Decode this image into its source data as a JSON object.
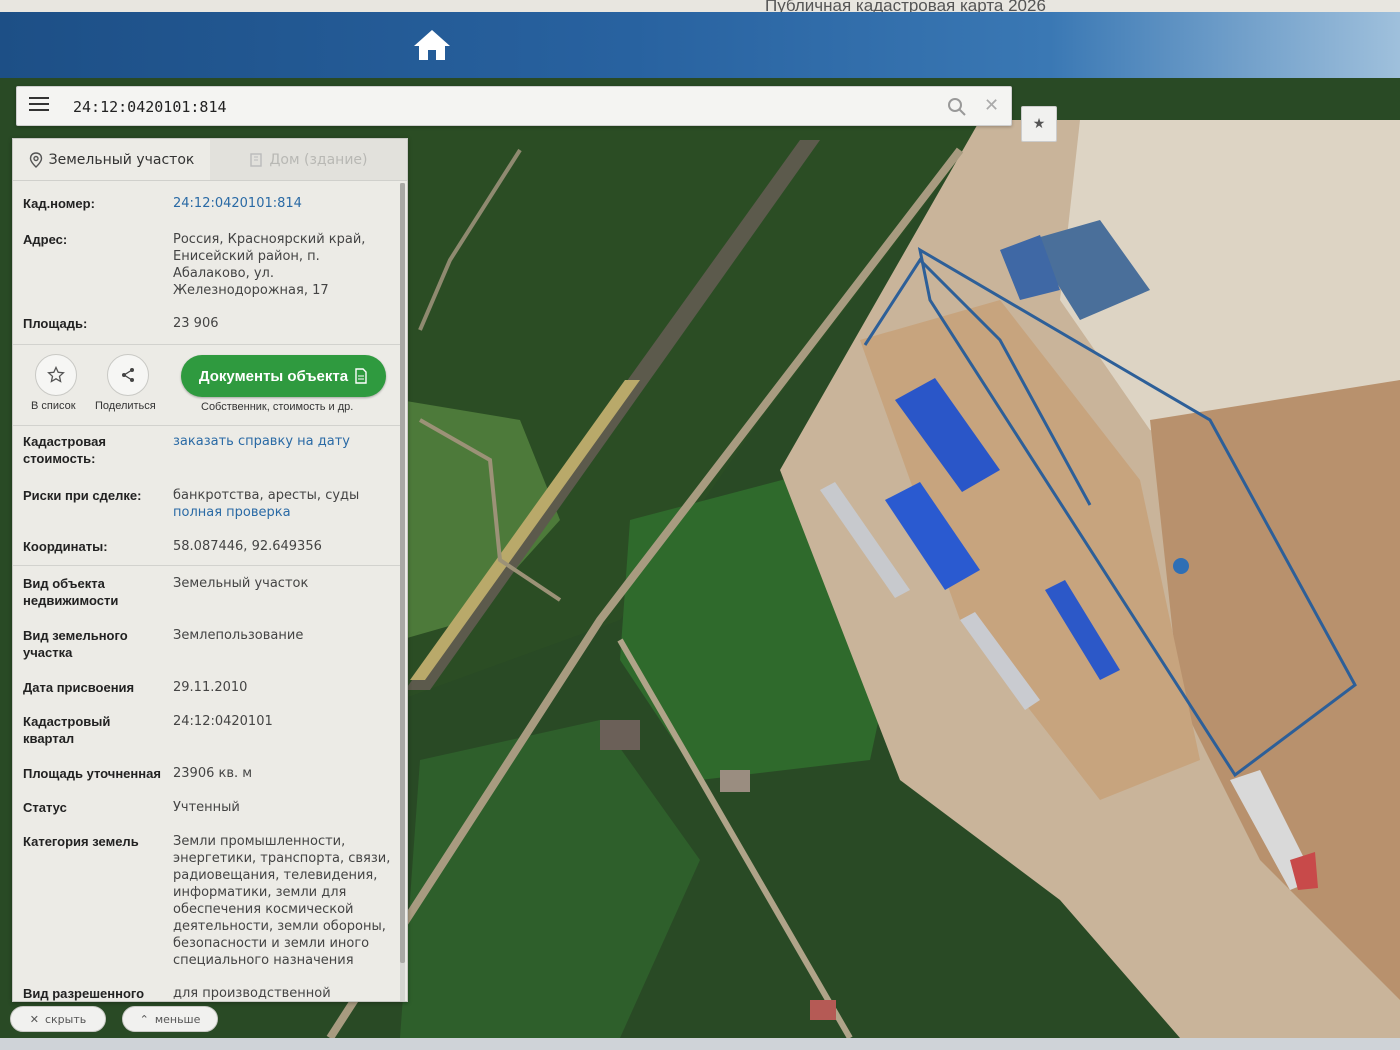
{
  "window": {
    "title": "Публичная кадастровая карта 2026"
  },
  "search": {
    "value": "24:12:0420101:814"
  },
  "tabs": [
    {
      "label": "Земельный участок",
      "active": true
    },
    {
      "label": "Дом (здание)",
      "active": false
    }
  ],
  "details_top": {
    "kad_label": "Кад.номер:",
    "kad_value": "24:12:0420101:814",
    "addr_label": "Адрес:",
    "addr_value": "Россия, Красноярский край, Енисейский район, п. Абалаково, ул. Железнодорожная, 17",
    "area_label": "Площадь:",
    "area_value": "23 906"
  },
  "actions": {
    "list_label": "В список",
    "share_label": "Поделиться",
    "docs_label": "Документы объекта",
    "docs_sub": "Собственник, стоимость и др."
  },
  "details": [
    {
      "label": "Кадастровая стоимость:",
      "value": "заказать справку на дату",
      "link": true
    },
    {
      "label": "Риски при сделке:",
      "value": "банкротства, аресты, суды",
      "value2": "полная проверка"
    },
    {
      "label": "Координаты:",
      "value": "58.087446, 92.649356"
    },
    {
      "label": "Вид объекта недвижимости",
      "value": "Земельный участок"
    },
    {
      "label": "Вид земельного участка",
      "value": "Землепользование"
    },
    {
      "label": "Дата присвоения",
      "value": "29.11.2010"
    },
    {
      "label": "Кадастровый квартал",
      "value": "24:12:0420101"
    },
    {
      "label": "Площадь уточненная",
      "value": "23906 кв. м"
    },
    {
      "label": "Статус",
      "value": "Учтенный"
    },
    {
      "label": "Категория земель",
      "value": "Земли промышленности, энергетики, транспорта, связи, радиовещания, телевидения, информатики, земли для обеспечения космической деятельности, земли обороны, безопасности и земли иного специального назначения"
    },
    {
      "label": "Вид разрешенного",
      "value": "для производственной"
    }
  ],
  "bottom": {
    "hide_label": "скрыть",
    "less_label": "меньше"
  },
  "colors": {
    "accent_blue": "#2862a0",
    "green_button": "#2f9a3f",
    "link": "#2a6aa5",
    "parcel_outline": "#2d5f98"
  },
  "icons": [
    "home-icon",
    "menu-icon",
    "search-icon",
    "close-icon",
    "star-icon",
    "share-icon",
    "document-icon",
    "pin-icon",
    "building-icon"
  ]
}
